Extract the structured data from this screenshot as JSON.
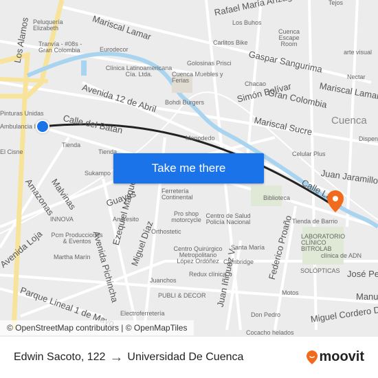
{
  "map": {
    "labels": [
      "Mariscal Lamar",
      "Rafael María Arízaga",
      "Gaspar Sangurima",
      "Gran Colombia",
      "Simón Bolívar",
      "Mariscal Sucre",
      "Mariscal Lamar",
      "Avenida 12 de Abril",
      "Calle del Batán",
      "Los Alamos",
      "Juan Jaramillo",
      "Calle Larga",
      "Guayas",
      "Malvinas",
      "Amazonas",
      "Avenida Loja",
      "Avenida Pichincha",
      "Ezequiel Márquez",
      "Miguel Díaz",
      "Juan Iñiguez V.",
      "Federico Proaño",
      "Parque Lineal 1 de Mayo",
      "Miguel Cordero D.",
      "José Peralta",
      "Manuel",
      "Cuenca",
      "Peluquería Elizabeth",
      "Tranvía - #08s - Gran Colombia",
      "Eurodecor",
      "Clínica Latinoamericana Cía. Ltda.",
      "Cuenca Muebles y Ferias",
      "Golosinas Prisci",
      "Carlitos Bike",
      "Los Buhos",
      "Cuenca Escape Room",
      "Bohdi Burgers",
      "Chacao",
      "Monodedo",
      "Celular Plus",
      "Biblioteca",
      "Tienda de Barrio",
      "LABORATORIO CLÍNICO BITROLAB",
      "clínica de ADN",
      "SOLÓPTICAS",
      "Motos",
      "Don Pedro",
      "Cocacho helados",
      "Electroferretería",
      "PUBLI & DECOR",
      "Juanchos",
      "Redux clínica",
      "Centro Quirúrgico Metropolitano López Ordóñez",
      "Cambridge",
      "Santa María",
      "Centro de Salud Policía Nacional",
      "Pro shop motorcycle",
      "Ferretería Continental",
      "Orthostetic",
      "Andresito",
      "INNOVA",
      "Pcm Producciones & Eventos",
      "Martha Marín",
      "Tienda",
      "Sukampo",
      "Pinturas Unidas",
      "Ambulancia IES",
      "El Cisne",
      "Tienda",
      "Tejos",
      "arte visual",
      "Nectar",
      "Dispen"
    ]
  },
  "cta": {
    "label": "Take me there"
  },
  "attribution": "© OpenStreetMap contributors | © OpenMapTiles",
  "footer": {
    "origin": "Edwin Sacoto, 122",
    "arrow": "→",
    "destination": "Universidad De Cuenca",
    "brand": "moovit"
  },
  "colors": {
    "button": "#1a73e8",
    "origin": "#1a73e8",
    "destination": "#f26b1d",
    "route": "#222222",
    "river": "#a8d4ef",
    "highway": "#f7e49a"
  }
}
